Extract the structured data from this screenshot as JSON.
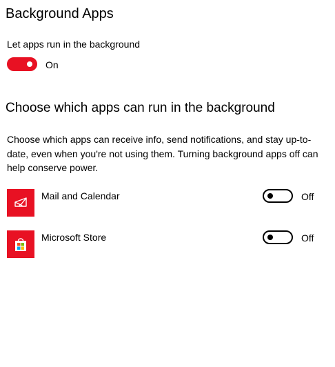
{
  "page": {
    "title": "Background Apps"
  },
  "master": {
    "label": "Let apps run in the background",
    "state": "On",
    "enabled": true
  },
  "section": {
    "heading": "Choose which apps can run in the background",
    "description": "Choose which apps can receive info, send notifications, and stay up-to-date, even when you're not using them. Turning background apps off can help conserve power."
  },
  "apps": [
    {
      "name": "Mail and Calendar",
      "icon": "mail-calendar-icon",
      "state": "Off",
      "enabled": false
    },
    {
      "name": "Microsoft Store",
      "icon": "store-bag-icon",
      "state": "Off",
      "enabled": false
    }
  ],
  "colors": {
    "accent": "#e81123",
    "text": "#000000",
    "background": "#ffffff"
  }
}
